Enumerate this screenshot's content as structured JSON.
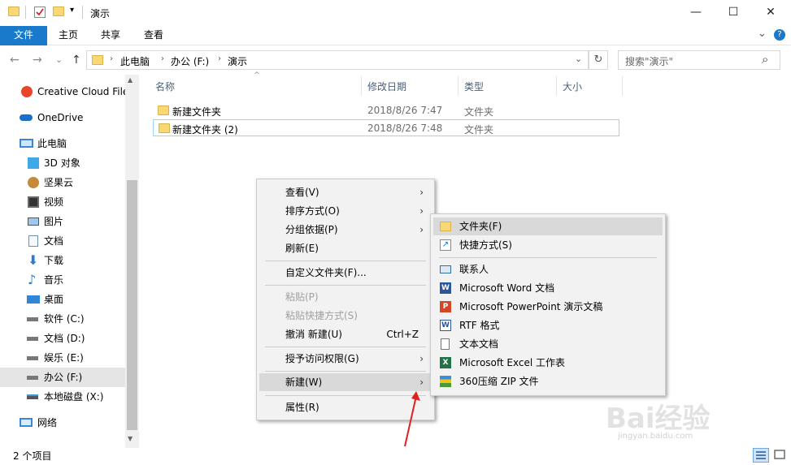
{
  "window": {
    "title": "演示",
    "minimize_glyph": "—",
    "maximize_glyph": "☐",
    "close_glyph": "✕"
  },
  "ribbon": {
    "tabs": [
      "文件",
      "主页",
      "共享",
      "查看"
    ],
    "expand_glyph": "⌄",
    "help_glyph": "?"
  },
  "nav": {
    "back_glyph": "←",
    "forward_glyph": "→",
    "recent_glyph": "⌄",
    "up_glyph": "↑",
    "breadcrumb": [
      "此电脑",
      "办公 (F:)",
      "演示"
    ],
    "crumb_sep": "›",
    "dropdown_glyph": "⌄",
    "refresh_glyph": "↻",
    "search_placeholder": "搜索\"演示\"",
    "search_glyph": "⌕"
  },
  "sidebar": {
    "items": [
      {
        "label": "Creative Cloud Files",
        "icon": "creative-cloud-icon"
      },
      {
        "label": "OneDrive",
        "icon": "onedrive-icon"
      },
      {
        "label": "此电脑",
        "icon": "computer-icon"
      },
      {
        "label": "3D 对象",
        "icon": "3d-objects-icon"
      },
      {
        "label": "坚果云",
        "icon": "nutstore-icon"
      },
      {
        "label": "视频",
        "icon": "videos-icon"
      },
      {
        "label": "图片",
        "icon": "pictures-icon"
      },
      {
        "label": "文档",
        "icon": "documents-icon"
      },
      {
        "label": "下载",
        "icon": "downloads-icon"
      },
      {
        "label": "音乐",
        "icon": "music-icon"
      },
      {
        "label": "桌面",
        "icon": "desktop-icon"
      },
      {
        "label": "软件 (C:)",
        "icon": "drive-icon"
      },
      {
        "label": "文档 (D:)",
        "icon": "drive-icon"
      },
      {
        "label": "娱乐 (E:)",
        "icon": "drive-icon"
      },
      {
        "label": "办公 (F:)",
        "icon": "drive-icon"
      },
      {
        "label": "本地磁盘 (X:)",
        "icon": "network-drive-icon"
      },
      {
        "label": "网络",
        "icon": "network-icon"
      }
    ],
    "scroll_up_glyph": "▲",
    "scroll_down_glyph": "▼"
  },
  "file_list": {
    "columns": [
      "名称",
      "修改日期",
      "类型",
      "大小"
    ],
    "sort_glyph": "^",
    "rows": [
      {
        "name": "新建文件夹",
        "modified": "2018/8/26 7:47",
        "type": "文件夹",
        "size": ""
      },
      {
        "name": "新建文件夹 (2)",
        "modified": "2018/8/26 7:48",
        "type": "文件夹",
        "size": ""
      }
    ]
  },
  "context_menu": {
    "arrow_glyph": "›",
    "items": {
      "view": "查看(V)",
      "sort": "排序方式(O)",
      "group": "分组依据(P)",
      "refresh": "刷新(E)",
      "customize": "自定义文件夹(F)...",
      "paste": "粘贴(P)",
      "paste_shortcut": "粘贴快捷方式(S)",
      "undo": "撤消 新建(U)",
      "undo_shortcut": "Ctrl+Z",
      "grant_access": "授予访问权限(G)",
      "new": "新建(W)",
      "properties": "属性(R)"
    }
  },
  "new_submenu": {
    "items": {
      "folder": "文件夹(F)",
      "shortcut": "快捷方式(S)",
      "contact": "联系人",
      "word": "Microsoft Word 文档",
      "powerpoint": "Microsoft PowerPoint 演示文稿",
      "rtf": "RTF 格式",
      "text": "文本文档",
      "excel": "Microsoft Excel 工作表",
      "zip": "360压缩 ZIP 文件"
    }
  },
  "status_bar": {
    "item_count": "2 个项目"
  },
  "watermark": {
    "brand": "Bai经验",
    "url": "jingyan.baidu.com"
  },
  "colors": {
    "accent": "#1979ca",
    "folder": "#f7d875",
    "selection_border": "#99d1ff",
    "annotation_arrow": "#e02020"
  }
}
